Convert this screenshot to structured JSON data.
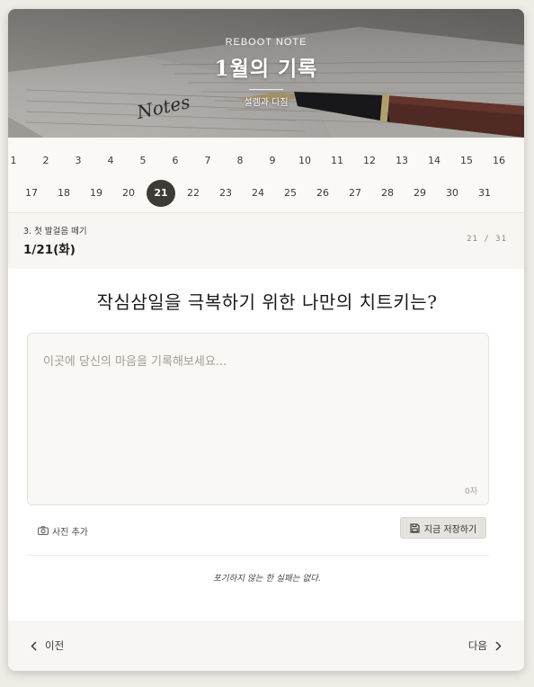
{
  "hero": {
    "eyebrow": "REBOOT NOTE",
    "title": "1월의 기록",
    "subtitle": "설렘과 다짐",
    "image_icon": "notebook-and-pen-photo",
    "image_text": "Notes"
  },
  "days": {
    "items": [
      "1",
      "2",
      "3",
      "4",
      "5",
      "6",
      "7",
      "8",
      "9",
      "10",
      "11",
      "12",
      "13",
      "14",
      "15",
      "16",
      "17",
      "18",
      "19",
      "20",
      "21",
      "22",
      "23",
      "24",
      "25",
      "26",
      "27",
      "28",
      "29",
      "30",
      "31"
    ],
    "selected": "21"
  },
  "entry": {
    "category": "3. 첫 발걸음 떼기",
    "date": "1/21(화)",
    "counter": "21 / 31"
  },
  "question": "작심삼일을 극복하기 위한 나만의 치트키는?",
  "answer": {
    "value": "",
    "placeholder": "이곳에 당신의 마음을 기록해보세요...",
    "char_count": "0자"
  },
  "actions": {
    "add_photo": "사진 추가",
    "add_photo_icon": "camera-icon",
    "save": "지금 저장하기",
    "save_icon": "floppy-disk-icon"
  },
  "quote": "포기하지 않는 한 실패는 없다.",
  "footer": {
    "prev": "이전",
    "next": "다음",
    "prev_icon": "chevron-left-icon",
    "next_icon": "chevron-right-icon"
  },
  "colors": {
    "accent": "#3e3a34",
    "page_bg": "#efece6",
    "panel_bg": "#f8f6f2"
  }
}
